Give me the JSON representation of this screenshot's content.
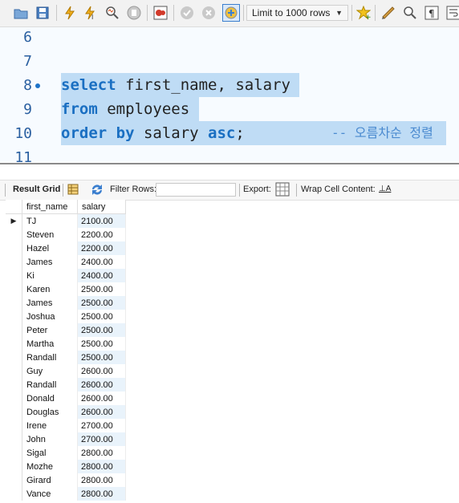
{
  "toolbar": {
    "limit_label": "Limit to 1000 rows",
    "buttons": [
      "open-folder-icon",
      "save-icon",
      "execute-icon",
      "execute-current-icon",
      "explain-icon",
      "stop-icon",
      "toggle-error-icon",
      "commit-icon",
      "rollback-icon",
      "autocommit-icon",
      "add-snippet-icon",
      "beautify-icon",
      "find-icon",
      "invisible-chars-icon",
      "wrap-icon"
    ]
  },
  "editor": {
    "lines": [
      {
        "num": "6"
      },
      {
        "num": "7"
      },
      {
        "num": "8"
      },
      {
        "num": "9"
      },
      {
        "num": "10"
      },
      {
        "num": "11"
      }
    ],
    "line8": {
      "kw": "select",
      "rest": " first_name, salary "
    },
    "line9": {
      "kw": "from",
      "rest": " employees "
    },
    "line10": {
      "kw1": "order by",
      "mid": " salary ",
      "kw2": "asc",
      "end": ";",
      "comment": "-- 오름차순 정렬"
    }
  },
  "result_toolbar": {
    "result_grid": "Result Grid",
    "filter_rows": "Filter Rows:",
    "export": "Export:",
    "wrap": "Wrap Cell Content:",
    "wrap_icon": "⊥A"
  },
  "grid": {
    "columns": [
      "first_name",
      "salary"
    ],
    "rows": [
      [
        "TJ",
        "2100.00"
      ],
      [
        "Steven",
        "2200.00"
      ],
      [
        "Hazel",
        "2200.00"
      ],
      [
        "James",
        "2400.00"
      ],
      [
        "Ki",
        "2400.00"
      ],
      [
        "Karen",
        "2500.00"
      ],
      [
        "James",
        "2500.00"
      ],
      [
        "Joshua",
        "2500.00"
      ],
      [
        "Peter",
        "2500.00"
      ],
      [
        "Martha",
        "2500.00"
      ],
      [
        "Randall",
        "2500.00"
      ],
      [
        "Guy",
        "2600.00"
      ],
      [
        "Randall",
        "2600.00"
      ],
      [
        "Donald",
        "2600.00"
      ],
      [
        "Douglas",
        "2600.00"
      ],
      [
        "Irene",
        "2700.00"
      ],
      [
        "John",
        "2700.00"
      ],
      [
        "Sigal",
        "2800.00"
      ],
      [
        "Mozhe",
        "2800.00"
      ],
      [
        "Girard",
        "2800.00"
      ],
      [
        "Vance",
        "2800.00"
      ]
    ]
  },
  "colors": {
    "keyword": "#1a6fc2",
    "selection": "#bfdcf5",
    "line_number": "#2a5fa0"
  }
}
